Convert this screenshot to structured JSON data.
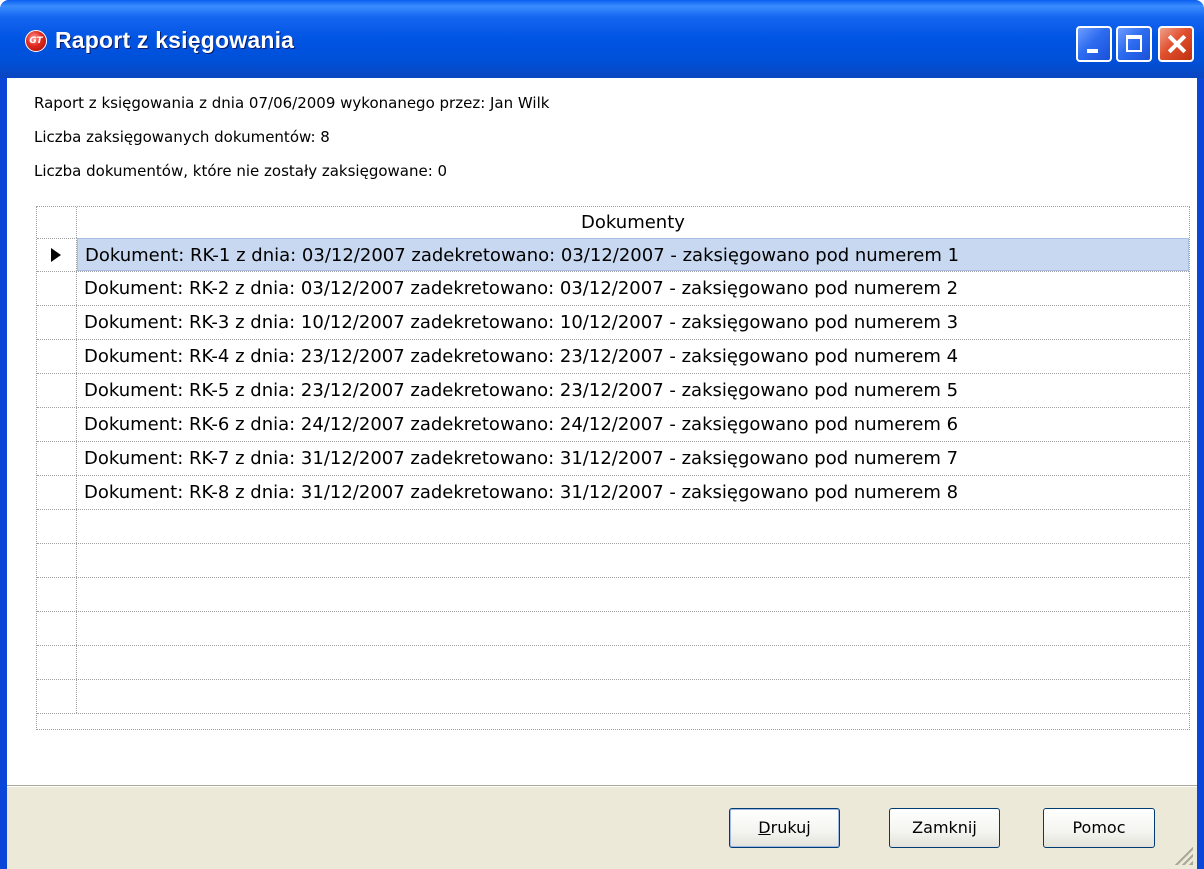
{
  "window": {
    "title": "Raport z księgowania",
    "app_icon_text": "GT"
  },
  "info": {
    "line1": "Raport z księgowania z dnia 07/06/2009 wykonanego przez: Jan Wilk",
    "line2": "Liczba zaksięgowanych dokumentów: 8",
    "line3": "Liczba dokumentów, które nie zostały zaksięgowane: 0"
  },
  "grid": {
    "column_header": "Dokumenty",
    "rows": [
      "Dokument: RK-1 z dnia: 03/12/2007 zadekretowano: 03/12/2007 - zaksięgowano pod numerem 1",
      "Dokument: RK-2 z dnia: 03/12/2007 zadekretowano: 03/12/2007 - zaksięgowano pod numerem 2",
      "Dokument: RK-3 z dnia: 10/12/2007 zadekretowano: 10/12/2007 - zaksięgowano pod numerem 3",
      "Dokument: RK-4 z dnia: 23/12/2007 zadekretowano: 23/12/2007 - zaksięgowano pod numerem 4",
      "Dokument: RK-5 z dnia: 23/12/2007 zadekretowano: 23/12/2007 - zaksięgowano pod numerem 5",
      "Dokument: RK-6 z dnia: 24/12/2007 zadekretowano: 24/12/2007 - zaksięgowano pod numerem 6",
      "Dokument: RK-7 z dnia: 31/12/2007 zadekretowano: 31/12/2007 - zaksięgowano pod numerem 7",
      "Dokument: RK-8 z dnia: 31/12/2007 zadekretowano: 31/12/2007 - zaksięgowano pod numerem 8",
      "",
      "",
      "",
      "",
      "",
      ""
    ],
    "selected_row": 0
  },
  "buttons": {
    "print": "Drukuj",
    "close": "Zamknij",
    "help": "Pomoc"
  },
  "colors": {
    "titlebar": "#0054e3",
    "selection": "#c8d8f0",
    "face": "#ece9d8"
  }
}
